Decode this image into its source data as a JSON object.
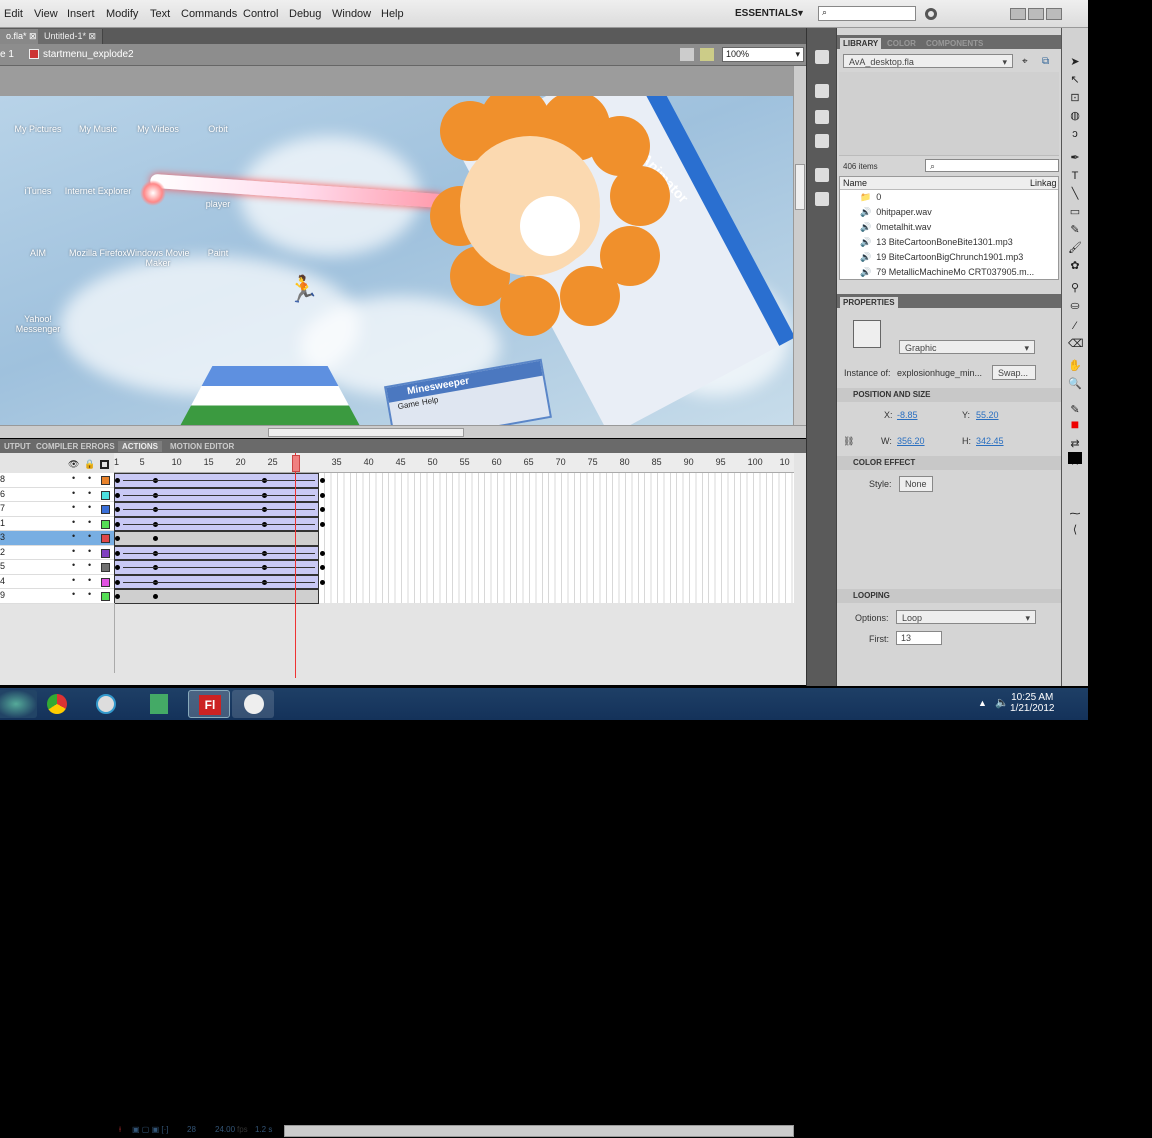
{
  "menu": [
    "Edit",
    "View",
    "Insert",
    "Modify",
    "Text",
    "Commands",
    "Control",
    "Debug",
    "Window",
    "Help"
  ],
  "workspace": "ESSENTIALS",
  "doc_tabs": [
    {
      "label": "o.fla*",
      "active": true
    },
    {
      "label": "Untitled-1*",
      "active": false
    }
  ],
  "breadcrumb": {
    "scene": "e 1",
    "symbol": "startmenu_explode2"
  },
  "zoom": "100%",
  "stage": {
    "icons": [
      {
        "label": "My Pictures"
      },
      {
        "label": "My Music"
      },
      {
        "label": "My Videos"
      },
      {
        "label": "Orbit"
      },
      {
        "label": "iTunes"
      },
      {
        "label": "Internet Explorer"
      },
      {
        "label": "player"
      },
      {
        "label": "AIM"
      },
      {
        "label": "Mozilla Firefox"
      },
      {
        "label": "Windows Movie Maker"
      },
      {
        "label": "Paint"
      },
      {
        "label": "Yahoo! Messenger"
      }
    ],
    "banner": "Animator",
    "window_title": "Minesweeper",
    "window_menu": [
      "Game",
      "Help"
    ]
  },
  "panel_tabs": [
    {
      "label": "UTPUT",
      "active": false
    },
    {
      "label": "COMPILER ERRORS",
      "active": false
    },
    {
      "label": "ACTIONS",
      "active": true
    },
    {
      "label": "MOTION EDITOR",
      "active": false
    }
  ],
  "timeline": {
    "ruler": [
      "1",
      "5",
      "10",
      "15",
      "20",
      "25",
      "35",
      "40",
      "45",
      "50",
      "55",
      "60",
      "65",
      "70",
      "75",
      "80",
      "85",
      "90",
      "95",
      "100",
      "10"
    ],
    "current_frame": "28",
    "fps": "24.00",
    "fps_unit": "fps",
    "time": "1.2 s",
    "layers": [
      {
        "name": "8",
        "color": "#e8822a",
        "tween": true
      },
      {
        "name": "6",
        "color": "#4de0e0",
        "tween": true
      },
      {
        "name": "7",
        "color": "#3a6fd8",
        "tween": true
      },
      {
        "name": "1",
        "color": "#55dd55",
        "tween": true
      },
      {
        "name": "3",
        "color": "#e04848",
        "tween": false,
        "selected": true
      },
      {
        "name": "2",
        "color": "#8040c0",
        "tween": true
      },
      {
        "name": "5",
        "color": "#707070",
        "tween": true
      },
      {
        "name": "4",
        "color": "#e050e0",
        "tween": true
      },
      {
        "name": "9",
        "color": "#55dd55",
        "tween": false
      }
    ]
  },
  "library": {
    "tabs": [
      "LIBRARY",
      "COLOR",
      "COMPONENTS"
    ],
    "file": "AvA_desktop.fla",
    "count": "406 items",
    "columns": [
      "Name",
      "Linkag"
    ],
    "items": [
      "0",
      "0hitpaper.wav",
      "0metalhit.wav",
      "13 BiteCartoonBoneBite1301.mp3",
      "19 BiteCartoonBigChrunch1901.mp3",
      "79 MetallicMachineMo CRT037905.m..."
    ]
  },
  "properties": {
    "title": "PROPERTIES",
    "type": "Graphic",
    "instance_label": "Instance of:",
    "instance": "explosionhuge_min...",
    "swap": "Swap...",
    "pos_title": "POSITION AND SIZE",
    "x_label": "X:",
    "x": "-8.85",
    "y_label": "Y:",
    "y": "55.20",
    "w_label": "W:",
    "w": "356.20",
    "h_label": "H:",
    "h": "342.45",
    "color_title": "COLOR EFFECT",
    "style_label": "Style:",
    "style": "None",
    "loop_title": "LOOPING",
    "options_label": "Options:",
    "options": "Loop",
    "first_label": "First:",
    "first": "13"
  },
  "taskbar": {
    "time": "10:25 AM",
    "date": "1/21/2012",
    "flash_label": "Fl"
  }
}
